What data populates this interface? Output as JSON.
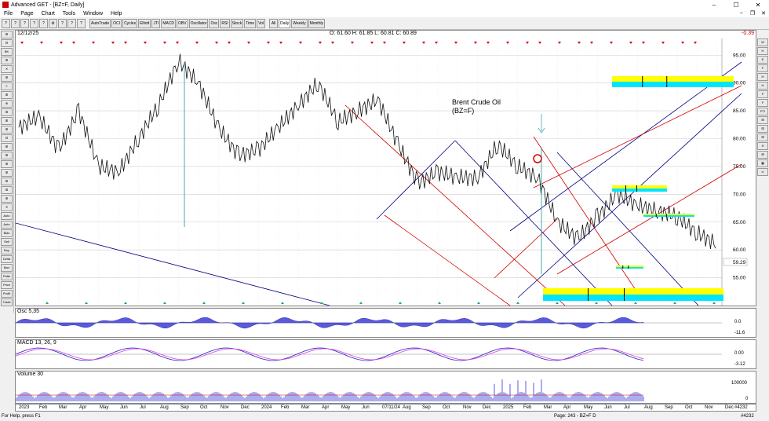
{
  "window": {
    "title": "Advanced GET - [BZ=F, Daily]",
    "minimize": "–",
    "maximize": "☐",
    "close": "✕"
  },
  "menu": [
    "File",
    "Page",
    "Chart",
    "Tools",
    "Window",
    "Help"
  ],
  "menu_right": [
    "–",
    "❐",
    "✕"
  ],
  "toolbar": [
    "?",
    "?",
    "?",
    "?",
    "?",
    "⚙",
    "?",
    "?",
    "?",
    "AutoTrade",
    "OCI",
    "Cycles",
    "Elliott",
    "JTI",
    "MACD",
    "OBV",
    "Oscillator",
    "Osc",
    "RSI",
    "Stock",
    "Time",
    "Vol",
    "All",
    "Daily",
    "Weekly",
    "Monthly"
  ],
  "toolbar_highlight": "Daily",
  "left_tools": [
    "⊞",
    "⊟",
    "BK",
    "⊞",
    "✕",
    "⊞",
    "≡",
    "⊞",
    "⊕",
    "⊞",
    "⊞",
    "⊞",
    "⊟",
    "⊞",
    "⊞",
    "⊞",
    "⊞",
    "⊞",
    "⊞",
    "⊞",
    "✕",
    "Auto",
    "Auto",
    "Bias",
    "Sell",
    "Buy",
    "Delta",
    "Mov",
    "Pattn",
    "Price",
    "Profit",
    "Trade"
  ],
  "right_tools": [
    "W",
    "H",
    "E",
    "F",
    "H",
    "H",
    "F",
    "F",
    "PTI",
    "⊞",
    "⊞",
    "⊞",
    "✕",
    "⊞",
    "▦",
    "U"
  ],
  "chart": {
    "date": "12/12/25",
    "ohlc": "O: 61.60   H: 61.85   L: 60.81   C: 60.89",
    "change": "-0.39",
    "annotation_title": "Brent Crude Oil",
    "annotation_symbol": "(BZ=F)",
    "last_price_label": "59.29",
    "accent_red": "#d00000",
    "accent_blue": "#000080",
    "highlight_yellow": "#ffff00",
    "highlight_cyan": "#00e5ff"
  },
  "osc_panel": {
    "label": "Osc 5,35",
    "zero": "0.0",
    "tick_low": "-11.6"
  },
  "macd_panel": {
    "label": "MACD 13, 26, 9",
    "zero": "0.00",
    "tick_low": "-3.12"
  },
  "volume_panel": {
    "label": "Volume 30",
    "tick_high": "100000",
    "tick_low": "0"
  },
  "time_axis": [
    "2023",
    "Feb",
    "Mar",
    "Apr",
    "May",
    "Jun",
    "Jul",
    "Aug",
    "Sep",
    "Oct",
    "Nov",
    "Dec",
    "2024",
    "Feb",
    "Mar",
    "Apr",
    "May",
    "Jun",
    "07/11/24",
    "Aug",
    "Sep",
    "Oct",
    "Nov",
    "Dec",
    "2025",
    "Feb",
    "Mar",
    "Apr",
    "May",
    "Jun",
    "Jul",
    "Aug",
    "Sep",
    "Oct",
    "Nov",
    "Dec"
  ],
  "time_axis_right": "#4232",
  "status": {
    "help": "For Help, press F1",
    "page": "Page: 243 - BZ=F D",
    "code": "#4232"
  },
  "chart_data": {
    "type": "line",
    "ylim": [
      50,
      98
    ],
    "y_ticks": [
      "95.00",
      "90.00",
      "85.00",
      "80.00",
      "75.00",
      "70.00",
      "65.00",
      "60.00",
      "55.00"
    ],
    "y_tick_values": [
      95,
      90,
      85,
      80,
      75,
      70,
      65,
      60,
      55
    ],
    "x": [
      "2023",
      "Feb",
      "Mar",
      "Apr",
      "May",
      "Jun",
      "Jul",
      "Aug",
      "Sep",
      "Oct",
      "Nov",
      "Dec",
      "2024",
      "Feb",
      "Mar",
      "Apr",
      "May",
      "Jun",
      "Jul",
      "Aug",
      "Sep",
      "Oct",
      "Nov",
      "Dec",
      "2025",
      "Feb",
      "Mar",
      "Apr",
      "May",
      "Jun",
      "Jul",
      "Aug",
      "Sep",
      "Oct",
      "Nov",
      "Dec"
    ],
    "close": [
      82,
      84,
      78,
      85,
      75,
      74,
      80,
      86,
      94,
      90,
      82,
      77,
      78,
      82,
      86,
      90,
      83,
      85,
      87,
      79,
      72,
      74,
      73,
      73,
      79,
      75,
      73,
      65,
      62,
      66,
      70,
      68,
      67,
      66,
      63,
      61
    ]
  }
}
